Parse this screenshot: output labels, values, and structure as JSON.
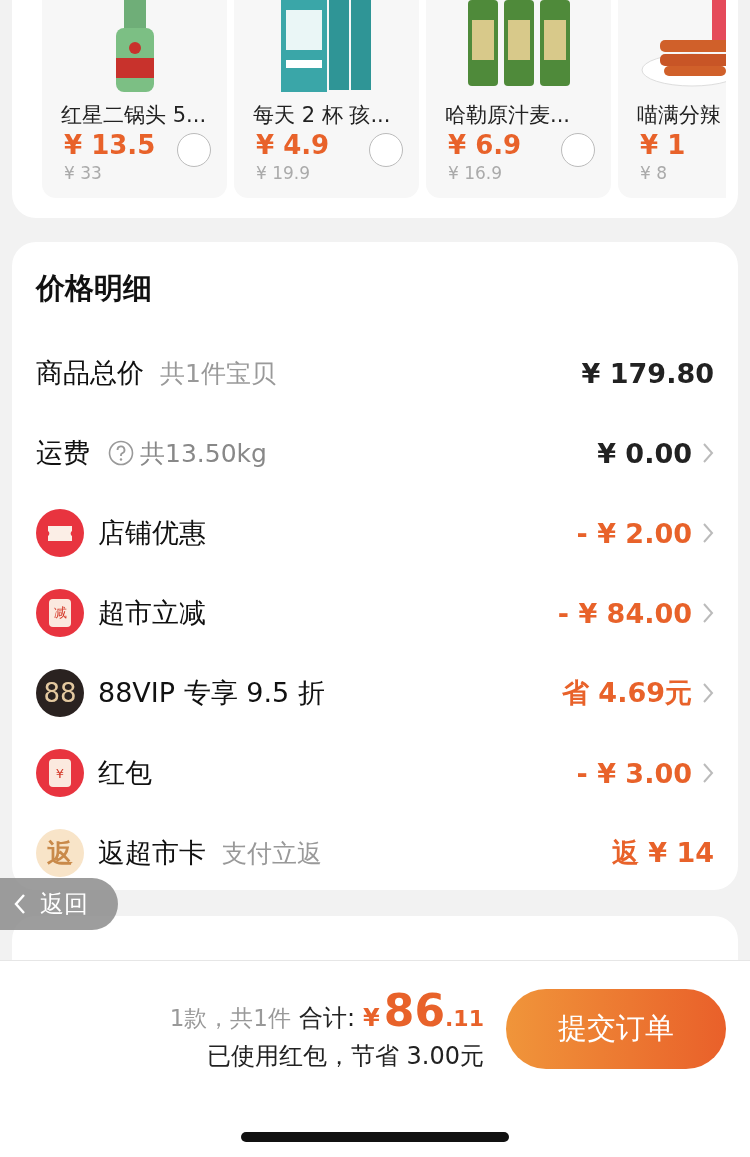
{
  "products": [
    {
      "name": "红星二锅头 5...",
      "price": "¥ 13.5",
      "original_price": "¥ 33",
      "selected": false,
      "kind": "bottle"
    },
    {
      "name": "每天 2 杯  孩...",
      "price": "¥ 4.9",
      "original_price": "¥ 19.9",
      "selected": false,
      "kind": "box"
    },
    {
      "name": "哈勒原汁麦...",
      "price": "¥ 6.9",
      "original_price": "¥ 16.9",
      "selected": false,
      "kind": "cans"
    },
    {
      "name": "喵满分辣",
      "price": "¥ 1",
      "original_price": "¥ 8",
      "kind": "snack"
    }
  ],
  "price_details": {
    "title": "价格明细",
    "rows": [
      {
        "kind": "plain",
        "label": "商品总价",
        "note": "共1件宝贝",
        "value": "¥ 179.80",
        "chevron": false
      },
      {
        "kind": "help",
        "label": "运费",
        "note": "共13.50kg",
        "value": "¥ 0.00",
        "chevron": true
      },
      {
        "kind": "ticket",
        "label": "店铺优惠",
        "value": "- ¥ 2.00",
        "chevron": true
      },
      {
        "kind": "jian",
        "label": "超市立减",
        "icon_text": "减",
        "value": "- ¥ 84.00",
        "chevron": true
      },
      {
        "kind": "vip",
        "label": "88VIP 专享 9.5 折",
        "icon_text": "88",
        "value": "省 4.69元",
        "chevron": true
      },
      {
        "kind": "envelope",
        "label": "红包",
        "icon_text": "¥",
        "value": "- ¥ 3.00",
        "chevron": true
      },
      {
        "kind": "fan",
        "label": "返超市卡",
        "icon_text": "返",
        "note": "支付立返",
        "value": "返 ¥ 14",
        "chevron": false
      }
    ]
  },
  "back_button": "返回",
  "footer": {
    "count": "1款，共1件",
    "total_label": "合计:",
    "currency": "¥",
    "total_int": "86",
    "total_dec": ".11",
    "saving": "已使用红包，节省 3.00元",
    "submit": "提交订单"
  }
}
